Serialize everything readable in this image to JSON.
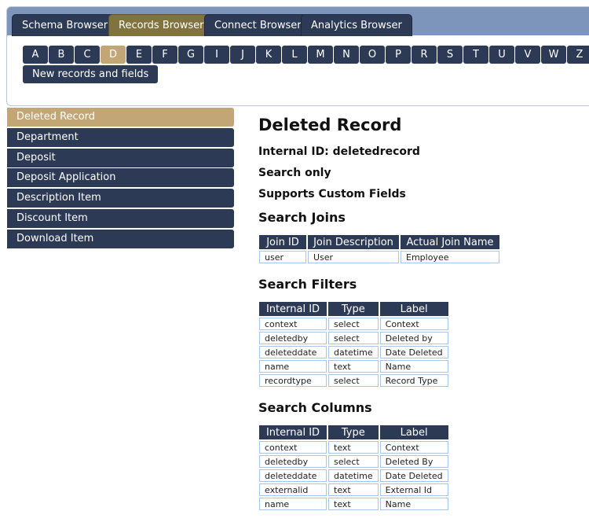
{
  "tabs": [
    {
      "label": "Schema Browser",
      "active": false
    },
    {
      "label": "Records Browser",
      "active": true
    },
    {
      "label": "Connect Browser",
      "active": false
    },
    {
      "label": "Analytics Browser",
      "active": false
    }
  ],
  "letters": [
    "A",
    "B",
    "C",
    "D",
    "E",
    "F",
    "G",
    "I",
    "J",
    "K",
    "L",
    "M",
    "N",
    "O",
    "P",
    "R",
    "S",
    "T",
    "U",
    "V",
    "W",
    "Z"
  ],
  "active_letter": "D",
  "new_records_label": "New records and fields",
  "sidebar": {
    "items": [
      "Deleted Record",
      "Department",
      "Deposit",
      "Deposit Application",
      "Description Item",
      "Discount Item",
      "Download Item"
    ],
    "active": "Deleted Record"
  },
  "record": {
    "title": "Deleted Record",
    "internal_id_line": "Internal ID: deletedrecord",
    "search_only": "Search only",
    "custom_fields": "Supports Custom Fields"
  },
  "search_joins": {
    "title": "Search Joins",
    "headers": [
      "Join ID",
      "Join Description",
      "Actual Join Name"
    ],
    "rows": [
      [
        "user",
        "User",
        "Employee"
      ]
    ]
  },
  "search_filters": {
    "title": "Search Filters",
    "headers": [
      "Internal ID",
      "Type",
      "Label"
    ],
    "rows": [
      [
        "context",
        "select",
        "Context"
      ],
      [
        "deletedby",
        "select",
        "Deleted by"
      ],
      [
        "deleteddate",
        "datetime",
        "Date Deleted"
      ],
      [
        "name",
        "text",
        "Name"
      ],
      [
        "recordtype",
        "select",
        "Record Type"
      ]
    ]
  },
  "search_columns": {
    "title": "Search Columns",
    "headers": [
      "Internal ID",
      "Type",
      "Label"
    ],
    "rows": [
      [
        "context",
        "text",
        "Context"
      ],
      [
        "deletedby",
        "select",
        "Deleted By"
      ],
      [
        "deleteddate",
        "datetime",
        "Date Deleted"
      ],
      [
        "externalid",
        "text",
        "External Id"
      ],
      [
        "name",
        "text",
        "Name"
      ]
    ]
  },
  "colors": {
    "nav_dark": "#2c3a56",
    "accent_gold": "#c2a676",
    "active_tab": "#80733e",
    "tabbar_bg": "#7d95bb",
    "cell_border": "#a9c6e8"
  }
}
